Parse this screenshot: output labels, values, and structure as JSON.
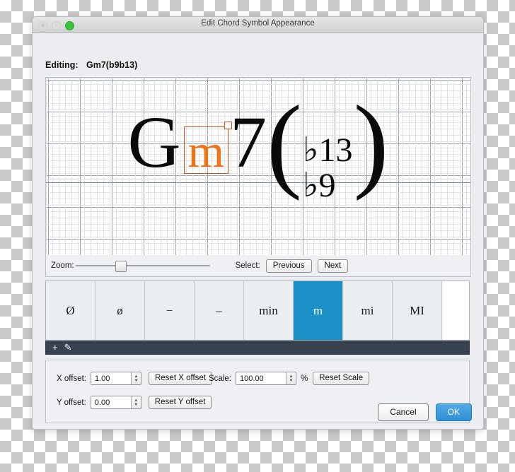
{
  "window": {
    "title": "Edit Chord Symbol Appearance",
    "traffic_lights": [
      {
        "name": "close-button",
        "state": "disabled"
      },
      {
        "name": "minimize-button",
        "state": "disabled"
      },
      {
        "name": "zoom-button",
        "state": "active",
        "color": "#3ec13e"
      }
    ]
  },
  "editing": {
    "label": "Editing:",
    "value": "Gm7(b9b13)"
  },
  "preview": {
    "chord": {
      "root": "G",
      "quality": "m",
      "quality_color": "#ef7215",
      "quality_selected": true,
      "seventh": "7",
      "paren_open": "(",
      "paren_close": ")",
      "alterations": [
        "♭13",
        "♭9"
      ]
    },
    "grid_visible": true,
    "baseline_visible": true
  },
  "zoom_strip": {
    "zoom_label": "Zoom:",
    "zoom_value": 25,
    "select_label": "Select:",
    "previous_label": "Previous",
    "next_label": "Next"
  },
  "variants": {
    "items": [
      {
        "label": "Ø",
        "selected": false
      },
      {
        "label": "ø",
        "selected": false
      },
      {
        "label": "−",
        "selected": false
      },
      {
        "label": "–",
        "selected": false
      },
      {
        "label": "min",
        "selected": false
      },
      {
        "label": "m",
        "selected": true
      },
      {
        "label": "mi",
        "selected": false
      },
      {
        "label": "MI",
        "selected": false
      }
    ],
    "selected_color": "#1a90c6",
    "toolbar": {
      "add_icon": "+",
      "edit_icon": "✎",
      "background": "#39434f"
    }
  },
  "offsets": {
    "x_label": "X offset:",
    "x_value": "1.00",
    "x_reset_label": "Reset X offset",
    "y_label": "Y offset:",
    "y_value": "0.00",
    "y_reset_label": "Reset Y offset",
    "scale_label": "Scale:",
    "scale_value": "100.00",
    "scale_unit": "%",
    "scale_reset_label": "Reset Scale"
  },
  "footer": {
    "cancel_label": "Cancel",
    "ok_label": "OK",
    "ok_color": "#2f8fd6"
  }
}
